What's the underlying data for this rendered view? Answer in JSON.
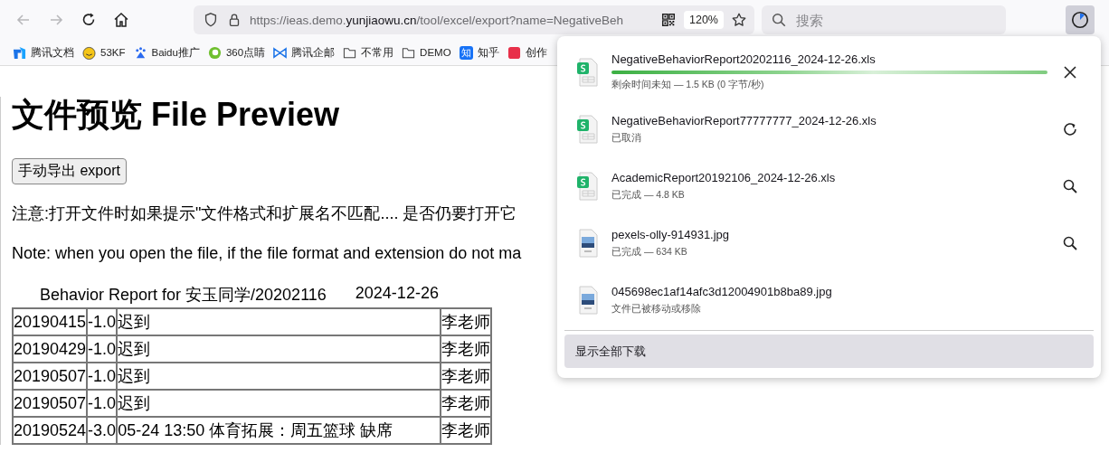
{
  "toolbar": {
    "back_disabled": true,
    "forward_disabled": true,
    "url": {
      "prefix": "https://ieas.demo.",
      "domain": "yunjiaowu.cn",
      "suffix": "/tool/excel/export?name=NegativeBeh"
    },
    "zoom": "120%",
    "search": {
      "placeholder": "搜索"
    },
    "downloads_open": true
  },
  "bookmarks": [
    {
      "kind": "doc",
      "label": "腾讯文档"
    },
    {
      "kind": "smile",
      "label": "53KF"
    },
    {
      "kind": "paw",
      "label": "Baidu推广"
    },
    {
      "kind": "ring",
      "label": "360点睛"
    },
    {
      "kind": "mail",
      "label": "腾讯企邮"
    },
    {
      "kind": "folder",
      "label": "不常用"
    },
    {
      "kind": "folder",
      "label": "DEMO"
    },
    {
      "kind": "glyph",
      "glyph": "知",
      "label": "知乎"
    },
    {
      "kind": "red",
      "label": "创作"
    }
  ],
  "page": {
    "title": "文件预览 File Preview",
    "export_button": "手动导出 export",
    "note_cn": "注意:打开文件时如果提示\"文件格式和扩展名不匹配.... 是否仍要打开它",
    "note_en": "Note: when you open the file, if the file format and extension do not ma",
    "caption": "Behavior Report for 安玉同学/20202116",
    "caption_date": "2024-12-26",
    "rows": [
      [
        "20190415",
        "-1.0",
        "迟到",
        "李老师"
      ],
      [
        "20190429",
        "-1.0",
        "迟到",
        "李老师"
      ],
      [
        "20190507",
        "-1.0",
        "迟到",
        "李老师"
      ],
      [
        "20190507",
        "-1.0",
        "迟到",
        "李老师"
      ],
      [
        "20190524",
        "-3.0",
        "05-24 13:50  体育拓展：周五篮球  缺席",
        "李老师"
      ]
    ]
  },
  "downloads": {
    "items": [
      {
        "kind": "xls",
        "name": "NegativeBehaviorReport20202116_2024-12-26.xls",
        "status": "剩余时间未知 — 1.5 KB (0 字节/秒)",
        "level": 1,
        "button": {
          "kind": "cancel"
        }
      },
      {
        "kind": "xls",
        "name": "NegativeBehaviorReport77777777_2024-12-26.xls",
        "status": "已取消",
        "button": {
          "kind": "retry"
        }
      },
      {
        "kind": "xls",
        "name": "AcademicReport20192106_2024-12-26.xls",
        "status": "已完成 — 4.8 KB",
        "button": {
          "kind": "show"
        }
      },
      {
        "kind": "jpg",
        "name": "pexels-olly-914931.jpg",
        "status": "已完成 — 634 KB",
        "button": {
          "kind": "show"
        }
      },
      {
        "kind": "jpg",
        "name": "045698ec1af14afc3d12004901b8ba89.jpg",
        "status": "文件已被移动或移除"
      }
    ],
    "show_all": "显示全部下载"
  }
}
